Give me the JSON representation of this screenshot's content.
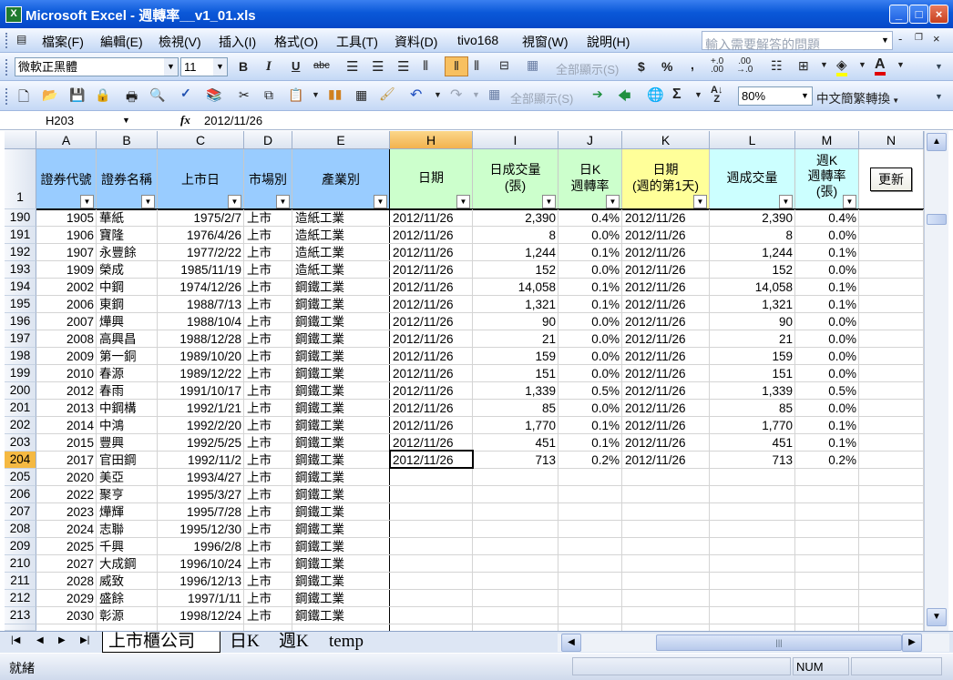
{
  "window": {
    "title": "Microsoft Excel - 週轉率__v1_01.xls",
    "app_icon": "X"
  },
  "menu": [
    "檔案(F)",
    "編輯(E)",
    "檢視(V)",
    "插入(I)",
    "格式(O)",
    "工具(T)",
    "資料(D)",
    "tivo168",
    "視窗(W)",
    "說明(H)"
  ],
  "help_box": {
    "placeholder": "輸入需要解答的問題"
  },
  "format_toolbar": {
    "font": "微軟正黑體",
    "size": "11",
    "show_all": "全部顯示(S)"
  },
  "standard_toolbar": {
    "show_all": "全部顯示(S)",
    "zoom": "80%",
    "convert": "中文簡繁轉換"
  },
  "formula": {
    "name_box": "H203",
    "fx": "fx",
    "value": "2012/11/26"
  },
  "columns": [
    "A",
    "B",
    "C",
    "D",
    "E",
    "H",
    "I",
    "J",
    "K",
    "L",
    "M",
    "N"
  ],
  "headers": {
    "A": "證券代號",
    "B": "證券名稱",
    "C": "上市日",
    "D": "市場別",
    "E": "產業別",
    "H": "日期",
    "I1": "日成交量",
    "I2": "(張)",
    "J1": "日K",
    "J2": "週轉率",
    "K1": "日期",
    "K2": "(週的第1天)",
    "L": "週成交量",
    "M1": "週K",
    "M2": "週轉率",
    "M3": "(張)",
    "update_button": "更新",
    "row1": "1"
  },
  "rows": [
    [
      "190",
      "1905",
      "華紙",
      "1975/2/7",
      "上市",
      "造紙工業",
      "2012/11/26",
      "2,390",
      "0.4%",
      "2012/11/26",
      "2,390",
      "0.4%"
    ],
    [
      "191",
      "1906",
      "寶隆",
      "1976/4/26",
      "上市",
      "造紙工業",
      "2012/11/26",
      "8",
      "0.0%",
      "2012/11/26",
      "8",
      "0.0%"
    ],
    [
      "192",
      "1907",
      "永豐餘",
      "1977/2/22",
      "上市",
      "造紙工業",
      "2012/11/26",
      "1,244",
      "0.1%",
      "2012/11/26",
      "1,244",
      "0.1%"
    ],
    [
      "193",
      "1909",
      "榮成",
      "1985/11/19",
      "上市",
      "造紙工業",
      "2012/11/26",
      "152",
      "0.0%",
      "2012/11/26",
      "152",
      "0.0%"
    ],
    [
      "194",
      "2002",
      "中鋼",
      "1974/12/26",
      "上市",
      "鋼鐵工業",
      "2012/11/26",
      "14,058",
      "0.1%",
      "2012/11/26",
      "14,058",
      "0.1%"
    ],
    [
      "195",
      "2006",
      "東鋼",
      "1988/7/13",
      "上市",
      "鋼鐵工業",
      "2012/11/26",
      "1,321",
      "0.1%",
      "2012/11/26",
      "1,321",
      "0.1%"
    ],
    [
      "196",
      "2007",
      "燁興",
      "1988/10/4",
      "上市",
      "鋼鐵工業",
      "2012/11/26",
      "90",
      "0.0%",
      "2012/11/26",
      "90",
      "0.0%"
    ],
    [
      "197",
      "2008",
      "高興昌",
      "1988/12/28",
      "上市",
      "鋼鐵工業",
      "2012/11/26",
      "21",
      "0.0%",
      "2012/11/26",
      "21",
      "0.0%"
    ],
    [
      "198",
      "2009",
      "第一銅",
      "1989/10/20",
      "上市",
      "鋼鐵工業",
      "2012/11/26",
      "159",
      "0.0%",
      "2012/11/26",
      "159",
      "0.0%"
    ],
    [
      "199",
      "2010",
      "春源",
      "1989/12/22",
      "上市",
      "鋼鐵工業",
      "2012/11/26",
      "151",
      "0.0%",
      "2012/11/26",
      "151",
      "0.0%"
    ],
    [
      "200",
      "2012",
      "春雨",
      "1991/10/17",
      "上市",
      "鋼鐵工業",
      "2012/11/26",
      "1,339",
      "0.5%",
      "2012/11/26",
      "1,339",
      "0.5%"
    ],
    [
      "201",
      "2013",
      "中鋼構",
      "1992/1/21",
      "上市",
      "鋼鐵工業",
      "2012/11/26",
      "85",
      "0.0%",
      "2012/11/26",
      "85",
      "0.0%"
    ],
    [
      "202",
      "2014",
      "中鴻",
      "1992/2/20",
      "上市",
      "鋼鐵工業",
      "2012/11/26",
      "1,770",
      "0.1%",
      "2012/11/26",
      "1,770",
      "0.1%"
    ],
    [
      "203",
      "2015",
      "豐興",
      "1992/5/25",
      "上市",
      "鋼鐵工業",
      "2012/11/26",
      "451",
      "0.1%",
      "2012/11/26",
      "451",
      "0.1%"
    ],
    [
      "204",
      "2017",
      "官田鋼",
      "1992/11/2",
      "上市",
      "鋼鐵工業",
      "2012/11/26",
      "713",
      "0.2%",
      "2012/11/26",
      "713",
      "0.2%"
    ],
    [
      "205",
      "2020",
      "美亞",
      "1993/4/27",
      "上市",
      "鋼鐵工業",
      "",
      "",
      "",
      "",
      "",
      ""
    ],
    [
      "206",
      "2022",
      "聚亨",
      "1995/3/27",
      "上市",
      "鋼鐵工業",
      "",
      "",
      "",
      "",
      "",
      ""
    ],
    [
      "207",
      "2023",
      "燁輝",
      "1995/7/28",
      "上市",
      "鋼鐵工業",
      "",
      "",
      "",
      "",
      "",
      ""
    ],
    [
      "208",
      "2024",
      "志聯",
      "1995/12/30",
      "上市",
      "鋼鐵工業",
      "",
      "",
      "",
      "",
      "",
      ""
    ],
    [
      "209",
      "2025",
      "千興",
      "1996/2/8",
      "上市",
      "鋼鐵工業",
      "",
      "",
      "",
      "",
      "",
      ""
    ],
    [
      "210",
      "2027",
      "大成鋼",
      "1996/10/24",
      "上市",
      "鋼鐵工業",
      "",
      "",
      "",
      "",
      "",
      ""
    ],
    [
      "211",
      "2028",
      "威致",
      "1996/12/13",
      "上市",
      "鋼鐵工業",
      "",
      "",
      "",
      "",
      "",
      ""
    ],
    [
      "212",
      "2029",
      "盛餘",
      "1997/1/11",
      "上市",
      "鋼鐵工業",
      "",
      "",
      "",
      "",
      "",
      ""
    ],
    [
      "213",
      "2030",
      "彰源",
      "1998/12/24",
      "上市",
      "鋼鐵工業",
      "",
      "",
      "",
      "",
      "",
      ""
    ]
  ],
  "sheets": [
    "上市櫃公司",
    "日K",
    "週K",
    "temp"
  ],
  "status": {
    "left": "就緒",
    "num": "NUM"
  },
  "colors": {
    "blue_header": "#99ccff",
    "green_header": "#ccffcc",
    "yellow_header": "#ffff99",
    "selected": "#f5b942"
  }
}
